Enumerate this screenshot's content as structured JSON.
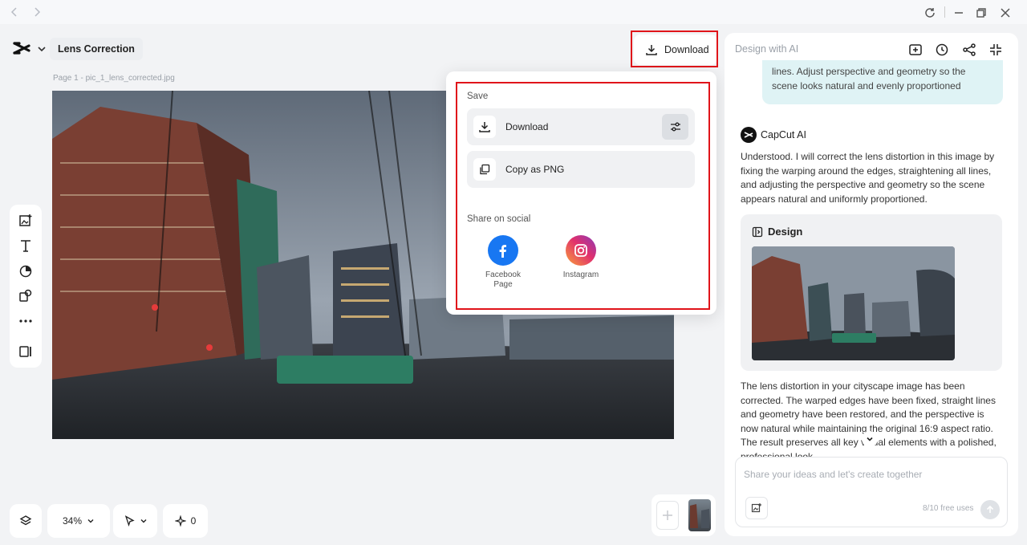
{
  "header": {
    "doc_name": "Lens Correction",
    "download_label": "Download",
    "page_label": "Page 1 -   pic_1_lens_corrected.jpg"
  },
  "bottom_bar": {
    "zoom": "34%",
    "magic_count": "0"
  },
  "popup": {
    "save_title": "Save",
    "download_label": "Download",
    "copy_label": "Copy as PNG",
    "share_title": "Share on social",
    "facebook_label": "Facebook Page",
    "instagram_label": "Instagram"
  },
  "right_panel": {
    "title": "Design with AI",
    "user_message_tail": "lines. Adjust perspective and geometry so the scene looks natural and evenly proportioned",
    "ai_name": "CapCut AI",
    "ai_reply": "Understood. I will correct the lens distortion in this image by fixing the warping around the edges, straightening all lines, and adjusting the perspective and geometry so the scene appears natural and uniformly proportioned.",
    "design_label": "Design",
    "result_text": "The lens distortion in your cityscape image has been corrected. The warped edges have been fixed, straight lines and geometry have been restored, and the perspective is now natural while maintaining the original 16:9 aspect ratio. The result preserves all key visual elements with a polished, professional look.",
    "input_placeholder": "Share your ideas and let's create together",
    "free_uses": "8/10 free uses"
  },
  "colors": {
    "highlight_red": "#e0141a",
    "facebook_blue": "#1877f2",
    "bubble_bg": "#dff3f5"
  }
}
